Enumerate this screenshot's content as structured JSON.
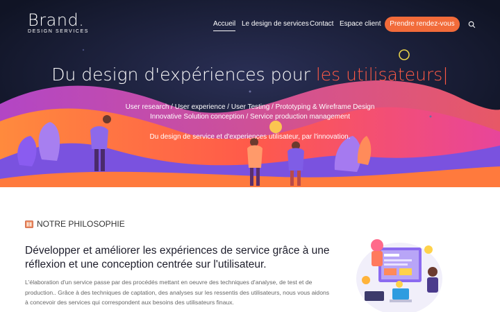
{
  "brand": {
    "name": "Brand.",
    "tagline": "DESIGN SERVICES"
  },
  "nav": {
    "items": [
      {
        "label": "Accueil",
        "active": true
      },
      {
        "label": "Le design de services",
        "active": false
      },
      {
        "label": "Contact",
        "active": false
      },
      {
        "label": "Espace client",
        "active": false
      }
    ],
    "cta_label": "Prendre rendez-vous",
    "search_icon": "search-icon"
  },
  "hero": {
    "title_prefix": "Du design d'expériences pour ",
    "title_accent": "les utilisateurs|",
    "line1": "User research / User experience / User Testing / Prototyping & Wireframe Design",
    "line2": "Innovative Solution conception / Service production management",
    "line3": "Du design de service et d'experiences utilisateur, par l'innovation."
  },
  "philosophy": {
    "label": "NOTRE PHILOSOPHIE",
    "icon": "book-icon",
    "title": "Développer et améliorer les expériences de service grâce à une réflexion et une conception centrée sur l'utilisateur.",
    "body": "L'élaboration d'un service passe par des procédés mettant en oeuvre des techniques d'analyse, de test et de production.. Grâce à des techniques de captation, des analyses sur les ressentis des utilisateurs, nous vous aidons à concevoir des services qui correspondent aux besoins des utilisateurs finaux."
  },
  "colors": {
    "accent": "#f26b3a",
    "hero_bg": "#101425",
    "purple": "#7b5fe0",
    "orange": "#ff7a3d"
  }
}
